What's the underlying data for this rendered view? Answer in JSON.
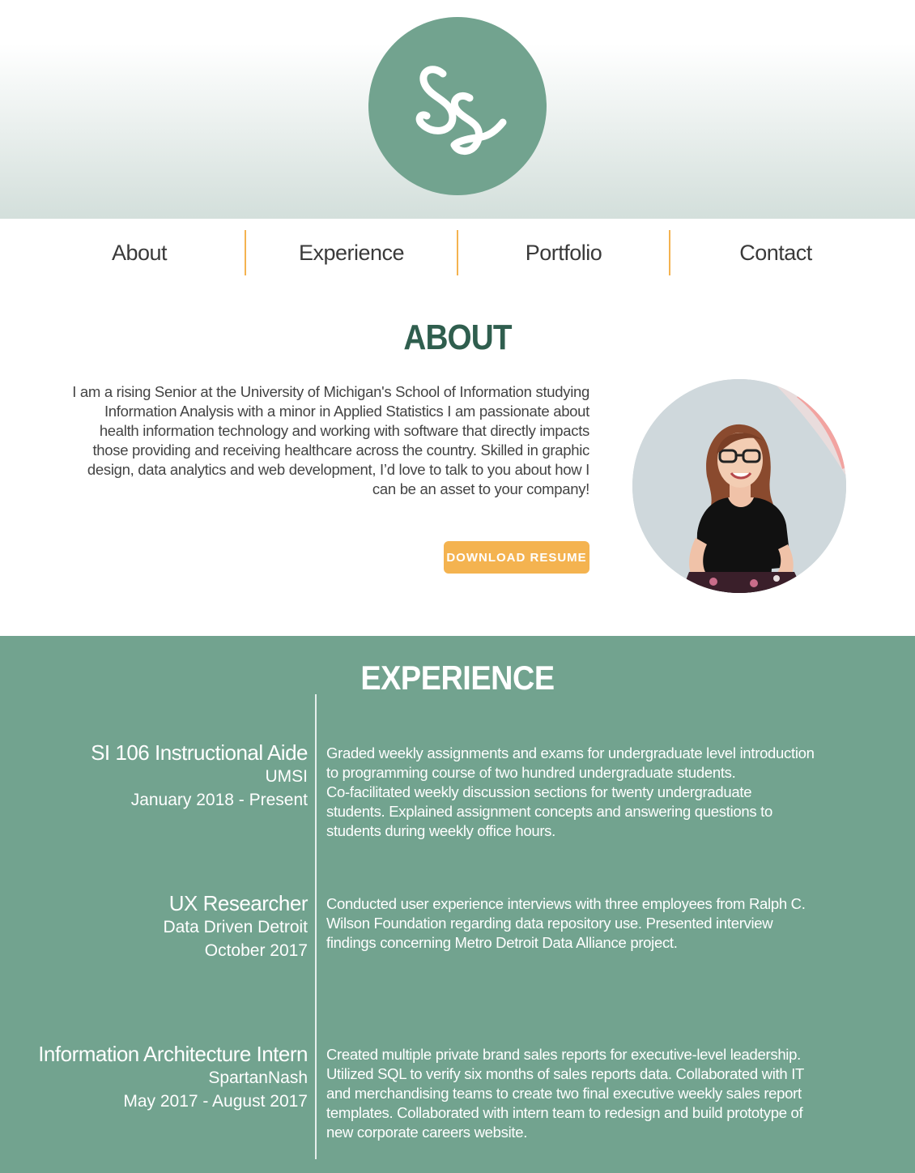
{
  "logo": {
    "letters": "Ss",
    "icon": "ss-monogram-icon"
  },
  "nav": {
    "items": [
      {
        "label": "About"
      },
      {
        "label": "Experience"
      },
      {
        "label": "Portfolio"
      },
      {
        "label": "Contact"
      }
    ]
  },
  "about": {
    "title": "ABOUT",
    "text_lines": [
      "I am a rising Senior at the University of Michigan's School of Information studying",
      "Information Analysis with a minor in Applied Statistics I am passionate about",
      "health information technology and working with software that directly impacts",
      "those providing and receiving healthcare across the country. Skilled in graphic",
      "design, data analytics and web development, I’d love to talk to you about how I",
      "can be an asset to your company!"
    ],
    "button_label": "DOWNLOAD RESUME",
    "photo_icon": "profile-photo"
  },
  "experience": {
    "title": "EXPERIENCE",
    "jobs": [
      {
        "role": "SI 106 Instructional Aide",
        "org": "UMSI",
        "dates": "January 2018 - Present",
        "desc_lines": [
          "Graded weekly assignments and exams for undergraduate level introduction",
          "to programming course of two hundred undergraduate students.",
          "Co-facilitated weekly discussion sections for twenty undergraduate",
          "students. Explained assignment concepts and answering questions to",
          "students during weekly office hours."
        ]
      },
      {
        "role": "UX Researcher",
        "org": "Data Driven Detroit",
        "dates": "October 2017",
        "desc_lines": [
          "Conducted user experience interviews with three employees from Ralph C.",
          "Wilson Foundation regarding data repository use. Presented interview",
          "findings concerning Metro Detroit Data Alliance project."
        ]
      },
      {
        "role": "Information Architecture Intern",
        "org": "SpartanNash",
        "dates": "May 2017 - August 2017",
        "desc_lines": [
          "Created multiple private brand sales reports for executive-level leadership.",
          "Utilized SQL to verify six months of sales reports data. Collaborated with IT",
          "and merchandising teams to create two final executive weekly sales report",
          "templates. Collaborated with intern team to redesign and build prototype of",
          "new corporate careers website."
        ]
      }
    ]
  },
  "colors": {
    "accent_green": "#72a38f",
    "dark_green": "#2f5e4e",
    "accent_orange": "#f4b350"
  }
}
